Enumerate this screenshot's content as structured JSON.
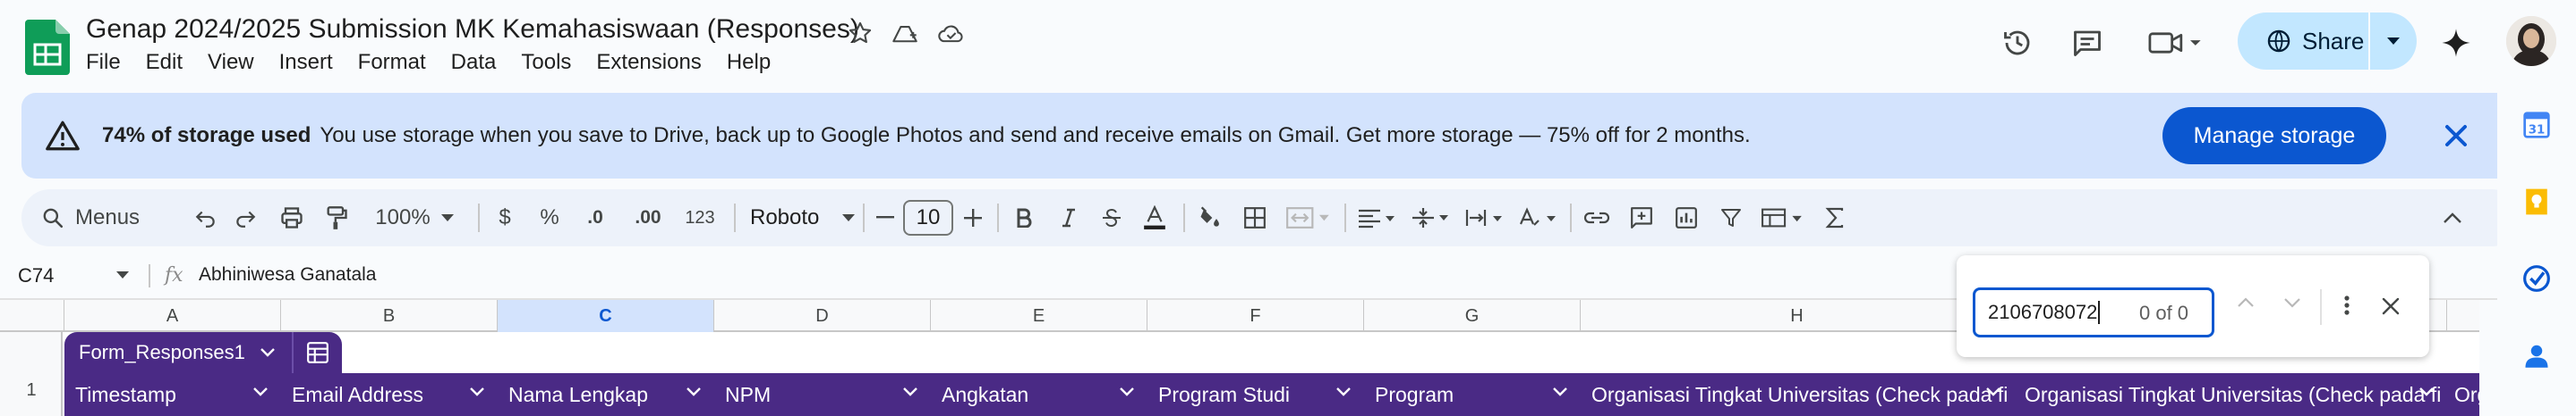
{
  "doc": {
    "title": "Genap 2024/2025 Submission MK Kemahasiswaan  (Responses)"
  },
  "menu": [
    "File",
    "Edit",
    "View",
    "Insert",
    "Format",
    "Data",
    "Tools",
    "Extensions",
    "Help"
  ],
  "share": {
    "label": "Share"
  },
  "banner": {
    "bold": "74% of storage used",
    "text": "You use storage when you save to Drive, back up to Google Photos and send and receive emails on Gmail. Get more storage — 75% off for 2 months.",
    "button": "Manage storage"
  },
  "toolbar": {
    "menus_label": "Menus",
    "zoom": "100%",
    "currency": "$",
    "percent": "%",
    "dec_decrease": ".0",
    "dec_increase": ".00",
    "number_format": "123",
    "font": "Roboto",
    "font_size": "10"
  },
  "formula_bar": {
    "cell_ref": "C74",
    "fx": "fx",
    "value": "Abhiniwesa Ganatala"
  },
  "columns": [
    "A",
    "B",
    "C",
    "D",
    "E",
    "F",
    "G",
    "H"
  ],
  "selected_column": "C",
  "table": {
    "name": "Form_Responses1",
    "row_number": "1",
    "headers": [
      "Timestamp",
      "Email Address",
      "Nama Lengkap",
      "NPM",
      "Angkatan",
      "Program Studi",
      "Program",
      "Organisasi Tingkat Universitas (Check pada fi",
      "Organisasi Tingkat Universitas (Check pada fi",
      "Org"
    ]
  },
  "find": {
    "query": "2106708072",
    "count": "0 of 0"
  },
  "colors": {
    "accent": "#0b57d0",
    "table_header": "#4a2a85",
    "banner_bg": "#d3e3fd",
    "share_bg": "#c2e7ff"
  }
}
